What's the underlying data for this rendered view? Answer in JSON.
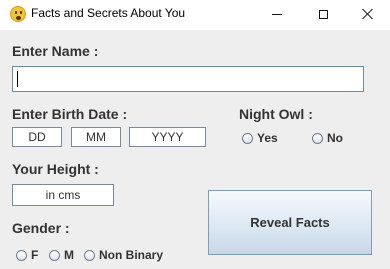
{
  "window": {
    "title": "Facts and Secrets About You",
    "app_icon": "surprised-face-icon",
    "controls": [
      "minimize-icon",
      "maximize-icon",
      "close-icon"
    ]
  },
  "form": {
    "name_label": "Enter Name :",
    "name_value": "",
    "birth_label": "Enter Birth Date :",
    "birth_day_placeholder": "DD",
    "birth_month_placeholder": "MM",
    "birth_year_placeholder": "YYYY",
    "night_owl_label": "Night Owl :",
    "night_owl_options": [
      "Yes",
      "No"
    ],
    "height_label": "Your Height :",
    "height_placeholder": "in cms",
    "gender_label": "Gender :",
    "gender_options": [
      "F",
      "M",
      "Non Binary"
    ],
    "reveal_button": "Reveal Facts"
  }
}
